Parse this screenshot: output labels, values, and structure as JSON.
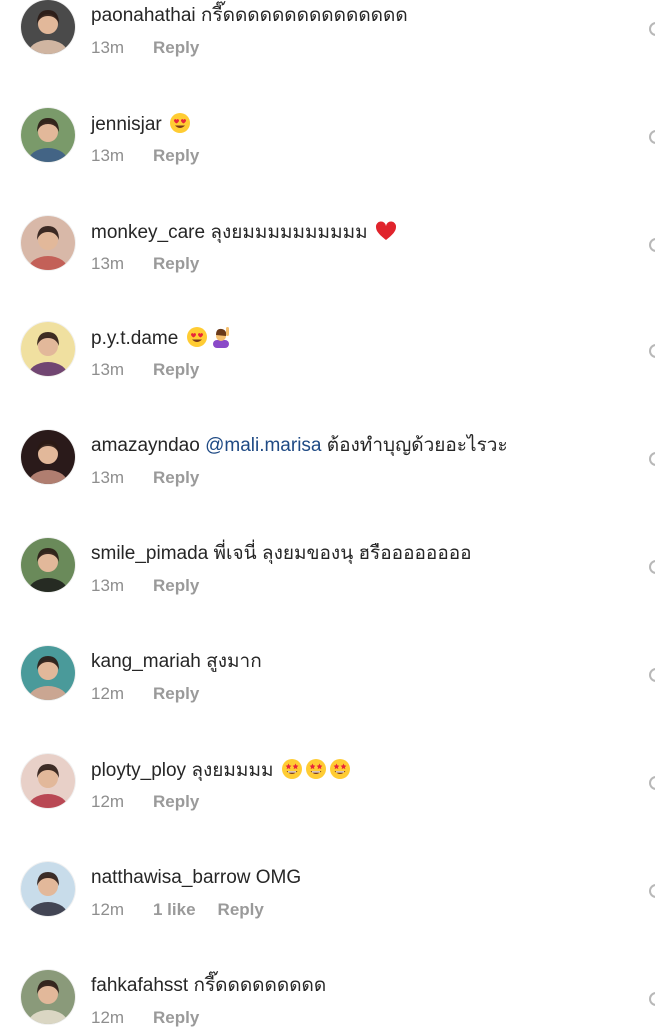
{
  "comments": [
    {
      "username": "paonahathai",
      "text": "กรี๊ดดดดดดดดดดดดดดด",
      "time": "13m",
      "likes": "",
      "reply": "Reply",
      "avatar": "profile-photo-woman-dark-hair",
      "colors": {
        "bg": "#4a4a4a",
        "fg": "#e8c8b0"
      }
    },
    {
      "username": "jennisjar",
      "text": "",
      "emojis": [
        "heart-eyes-emoji"
      ],
      "time": "13m",
      "likes": "",
      "reply": "Reply",
      "avatar": "profile-photo-couple-outdoors",
      "colors": {
        "bg": "#7a9a6a",
        "fg": "#3a5a8a"
      }
    },
    {
      "username": "monkey_care",
      "text": "ลุงยมมมมมมมมมม",
      "emojis": [
        "red-heart-emoji"
      ],
      "time": "13m",
      "likes": "",
      "reply": "Reply",
      "avatar": "profile-photo-red-shoes",
      "colors": {
        "bg": "#d8b8a8",
        "fg": "#c0504a"
      }
    },
    {
      "username": "p.y.t.dame",
      "text": "",
      "emojis": [
        "heart-eyes-emoji",
        "person-raising-hand-emoji"
      ],
      "time": "13m",
      "likes": "",
      "reply": "Reply",
      "avatar": "profile-photo-woman-purple",
      "colors": {
        "bg": "#f0e0a0",
        "fg": "#5a2a6a"
      }
    },
    {
      "username": "amazayndao",
      "mention": "@mali.marisa",
      "text": "ต้องทำบุญด้วยอะไรวะ",
      "time": "13m",
      "likes": "",
      "reply": "Reply",
      "avatar": "profile-photo-woman-closeup",
      "colors": {
        "bg": "#2a1a1a",
        "fg": "#c89080"
      }
    },
    {
      "username": "smile_pimada",
      "text": "พี่เจนี่ ลุงยมของนุ ฮรืออออออออ",
      "time": "13m",
      "likes": "",
      "reply": "Reply",
      "avatar": "profile-photo-woman-garden",
      "colors": {
        "bg": "#6a8a5a",
        "fg": "#1a1a1a"
      }
    },
    {
      "username": "kang_mariah",
      "text": "สูงมาก",
      "time": "12m",
      "likes": "",
      "reply": "Reply",
      "avatar": "profile-photo-woman-beanie",
      "colors": {
        "bg": "#4a9a9a",
        "fg": "#e0a890"
      }
    },
    {
      "username": "ployty_ploy",
      "text": "ลุงยมมมม",
      "emojis": [
        "star-struck-emoji",
        "star-struck-emoji",
        "star-struck-emoji"
      ],
      "time": "12m",
      "likes": "",
      "reply": "Reply",
      "avatar": "profile-photo-woman-red-lips",
      "colors": {
        "bg": "#e8d0c8",
        "fg": "#b03040"
      }
    },
    {
      "username": "natthawisa_barrow",
      "text": "OMG",
      "time": "12m",
      "likes": "1 like",
      "reply": "Reply",
      "avatar": "profile-photo-woman-sky",
      "colors": {
        "bg": "#c8dcea",
        "fg": "#2a2a3a"
      }
    },
    {
      "username": "fahkafahsst",
      "text": "กรี๊ดดดดดดดดด",
      "time": "12m",
      "likes": "",
      "reply": "Reply",
      "avatar": "profile-photo-flower-arch",
      "colors": {
        "bg": "#8a9a7a",
        "fg": "#e8e0d0"
      }
    }
  ]
}
